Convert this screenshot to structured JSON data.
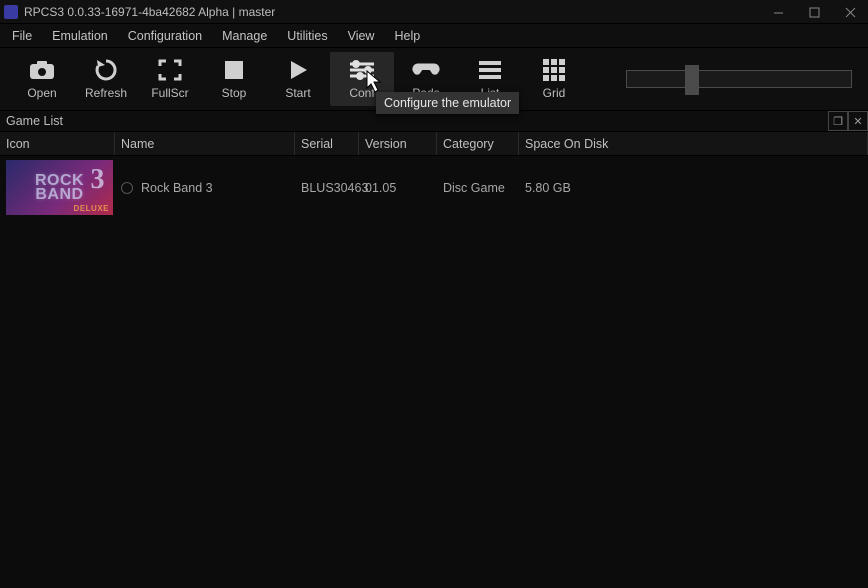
{
  "window": {
    "title": "RPCS3 0.0.33-16971-4ba42682 Alpha | master"
  },
  "menu": {
    "items": [
      "File",
      "Emulation",
      "Configuration",
      "Manage",
      "Utilities",
      "View",
      "Help"
    ]
  },
  "toolbar": {
    "open": "Open",
    "refresh": "Refresh",
    "fullscr": "FullScr",
    "stop": "Stop",
    "start": "Start",
    "config": "Conf",
    "pads": "Pads",
    "list": "List",
    "grid": "Grid"
  },
  "tooltip": {
    "config": "Configure the emulator"
  },
  "panel": {
    "title": "Game List"
  },
  "columns": {
    "icon": "Icon",
    "name": "Name",
    "serial": "Serial",
    "version": "Version",
    "category": "Category",
    "space": "Space On Disk"
  },
  "games": [
    {
      "icon_label_top": "ROCK",
      "icon_label_bottom": "BAND",
      "icon_three": "3",
      "icon_deluxe": "DELUXE",
      "name": "Rock Band 3",
      "serial": "BLUS30463",
      "version": "01.05",
      "category": "Disc Game",
      "space": "5.80 GB"
    }
  ]
}
